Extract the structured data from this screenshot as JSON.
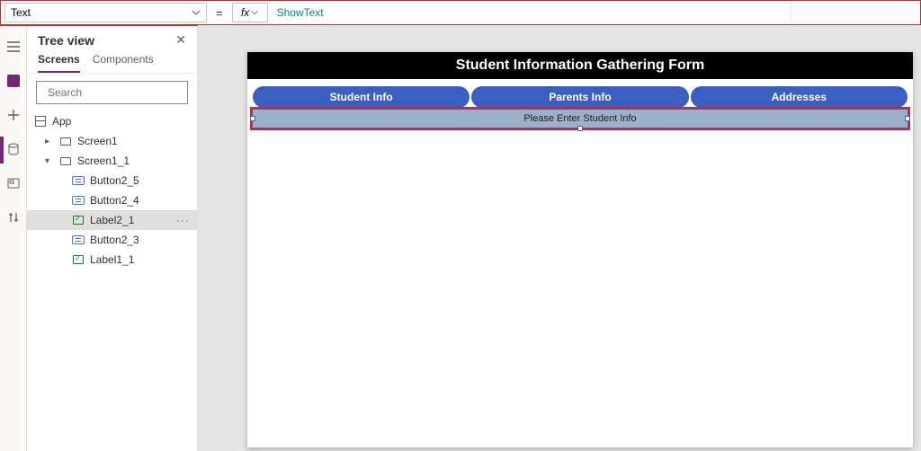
{
  "formula_bar": {
    "property": "Text",
    "fx_label": "fx",
    "value": "ShowText"
  },
  "tree": {
    "title": "Tree view",
    "tabs": {
      "screens": "Screens",
      "components": "Components"
    },
    "search_placeholder": "Search",
    "app": "App",
    "items": [
      {
        "name": "Screen1",
        "kind": "screen",
        "expand": "closed",
        "depth": 1
      },
      {
        "name": "Screen1_1",
        "kind": "screen",
        "expand": "open",
        "depth": 1
      },
      {
        "name": "Button2_5",
        "kind": "button",
        "depth": 2
      },
      {
        "name": "Button2_4",
        "kind": "button",
        "depth": 2
      },
      {
        "name": "Label2_1",
        "kind": "label",
        "depth": 2,
        "selected": true
      },
      {
        "name": "Button2_3",
        "kind": "button",
        "depth": 2
      },
      {
        "name": "Label1_1",
        "kind": "label",
        "depth": 2
      }
    ]
  },
  "canvas": {
    "title": "Student Information Gathering Form",
    "tabs": [
      "Student Info",
      "Parents Info",
      "Addresses"
    ],
    "info_bar": "Please Enter Student Info"
  }
}
